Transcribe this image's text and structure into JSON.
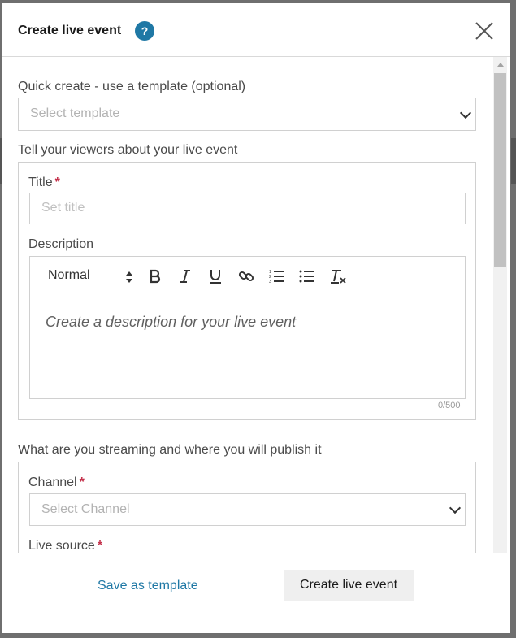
{
  "dialog": {
    "title": "Create live event",
    "help_glyph": "?"
  },
  "quick_create": {
    "label": "Quick create - use a template (optional)",
    "placeholder": "Select template"
  },
  "viewers_section": {
    "heading": "Tell your viewers about your live event",
    "title_label": "Title",
    "title_placeholder": "Set title",
    "description_label": "Description",
    "format_value": "Normal",
    "description_placeholder": "Create a description for your live event",
    "char_counter": "0/500"
  },
  "stream_section": {
    "heading": "What are you streaming and where you will publish it",
    "channel_label": "Channel",
    "channel_placeholder": "Select Channel",
    "source_label": "Live source"
  },
  "required_marker": "*",
  "footer": {
    "save_template": "Save as template",
    "create": "Create live event"
  },
  "toolbar_icons": [
    "bold-icon",
    "italic-icon",
    "underline-icon",
    "link-icon",
    "ordered-list-icon",
    "bullet-list-icon",
    "clear-format-icon"
  ],
  "colors": {
    "accent": "#1f78a5",
    "required": "#c4314b"
  }
}
